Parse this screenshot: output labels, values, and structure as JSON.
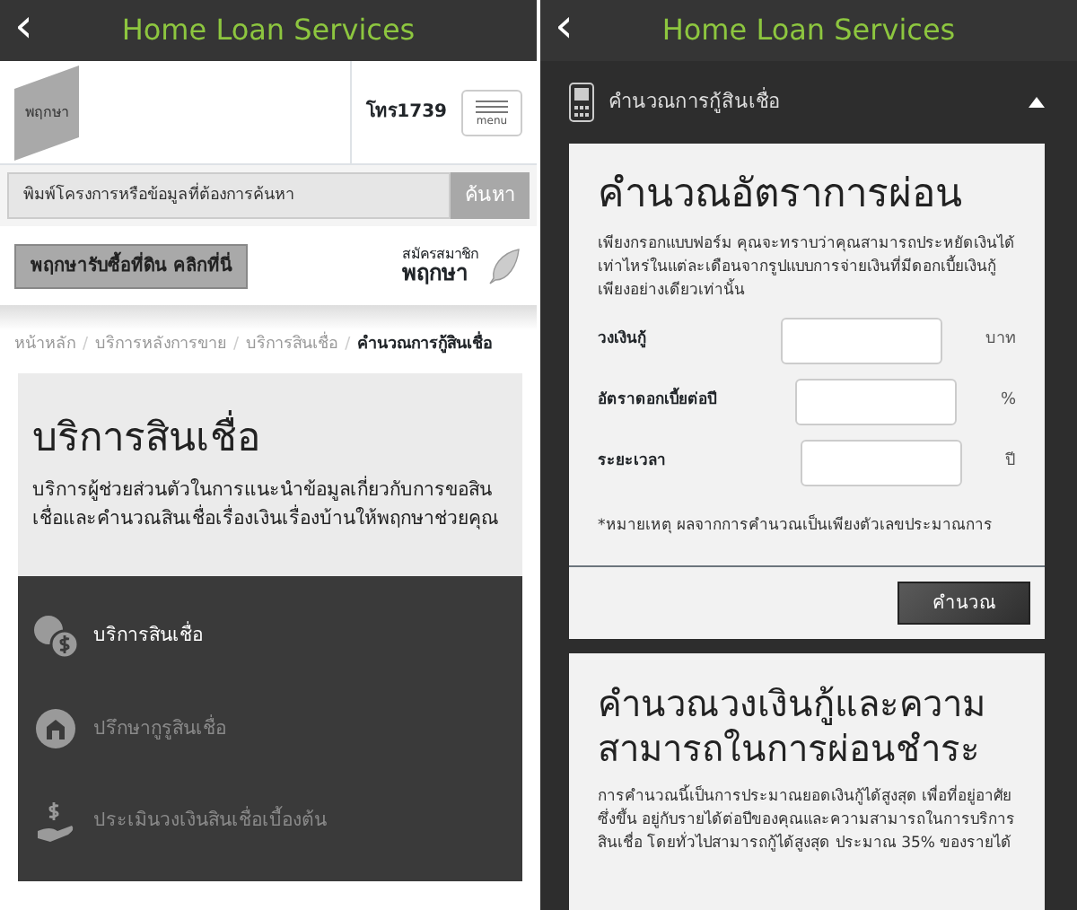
{
  "left_screen": {
    "header": {
      "title": "Home Loan Services",
      "back": "‹"
    },
    "logo": {
      "text": "พฤกษา"
    },
    "phone": "โทร1739",
    "menu_button": {
      "label": "menu"
    },
    "search": {
      "placeholder": "พิมพ์โครงการหรือข้อมูลที่ต้องการค้นหา",
      "button": "ค้นหา"
    },
    "promo_button": "พฤกษารับซื้อที่ดิน คลิกที่นี่",
    "member": {
      "line_1": "สมัครสมาชิก",
      "line_2": "พฤกษา"
    },
    "breadcrumb_separator": "/",
    "breadcrumb": [
      {
        "label": "หน้าหลัก",
        "current": false
      },
      {
        "label": "บริการหลังการขาย",
        "current": false
      },
      {
        "label": "บริการสินเชื่อ",
        "current": false
      },
      {
        "label": "คำนวณการกู้สินเชื่อ",
        "current": true
      }
    ],
    "hero": {
      "title": "บริการสินเชื่อ",
      "description": "บริการผู้ช่วยส่วนตัวในการแนะนำข้อมูลเกี่ยวกับการขอสินเชื่อและคำนวณสินเชื่อเรื่องเงินเรื่องบ้านให้พฤกษาช่วยคุณ"
    },
    "menu_items": [
      {
        "label": "บริการสินเชื่อ",
        "kind": "coins",
        "selected": true
      },
      {
        "label": "ปรึกษากูรูสินเชื่อ",
        "kind": "house",
        "selected": false
      },
      {
        "label": "ประเมินวงเงินสินเชื่อเบื้องต้น",
        "kind": "hand",
        "selected": false
      }
    ]
  },
  "right_screen": {
    "header": {
      "title": "Home Loan Services",
      "back": "‹"
    },
    "accordion": {
      "title": "คำนวณการกู้สินเชื่อ",
      "expanded": true
    },
    "calculator": {
      "title": "คำนวณอัตราการผ่อน",
      "description": "เพียงกรอกแบบฟอร์ม คุณจะทราบว่าคุณสามารถประหยัดเงินได้เท่าไหร่ในแต่ละเดือนจากรูปแบบการจ่ายเงินที่มีดอกเบี้ยเงินกู้เพียงอย่างเดียวเท่านั้น",
      "fields": [
        {
          "label": "วงเงินกู้",
          "unit": "บาท"
        },
        {
          "label": "อัตราดอกเบี้ยต่อปี",
          "unit": "%"
        },
        {
          "label": "ระยะเวลา",
          "unit": "ปี"
        }
      ],
      "note": "*หมายเหตุ ผลจากการคำนวณเป็นเพียงตัวเลขประมาณการ",
      "button": "คำนวณ"
    },
    "capacity": {
      "title": "คำนวณวงเงินกู้และความสามารถในการผ่อนชำระ",
      "description": "การคำนวณนี้เป็นการประมาณยอดเงินกู้ได้สูงสุด เพื่อที่อยู่อาศัยซึ่งขึ้น อยู่กับรายได้ต่อปีของคุณและความสามารถในการบริการสินเชื่อ โดยทั่วไปสามารถกู้ได้สูงสุด ประมาณ 35% ของรายได้"
    }
  }
}
